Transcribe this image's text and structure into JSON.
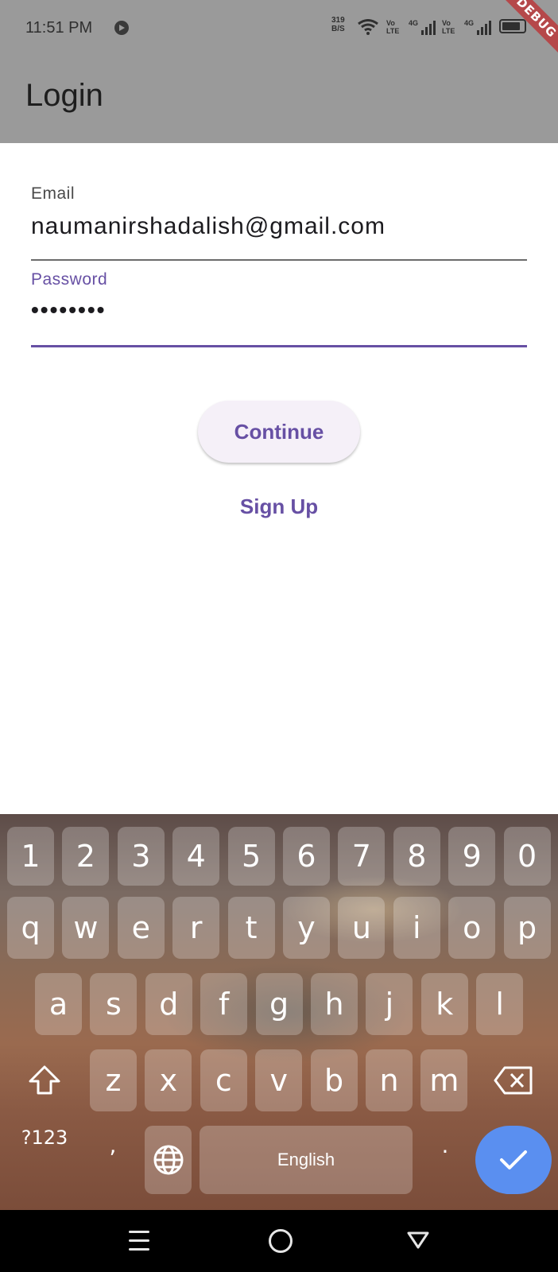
{
  "status_bar": {
    "time": "11:51 PM",
    "net_speed_value": "319",
    "net_speed_unit": "B/S",
    "sim1_type": "Vo\nLTE",
    "sim1_network": "4G",
    "sim2_type": "Vo\nLTE",
    "sim2_network": "4G",
    "battery_level": 0.85
  },
  "debug_banner": "DEBUG",
  "app_bar": {
    "title": "Login"
  },
  "form": {
    "email": {
      "label": "Email",
      "value": "naumanirshadalish@gmail.com"
    },
    "password": {
      "label": "Password",
      "value": "••••••••"
    }
  },
  "buttons": {
    "continue": "Continue",
    "sign_up": "Sign Up"
  },
  "keyboard": {
    "numbers": [
      "1",
      "2",
      "3",
      "4",
      "5",
      "6",
      "7",
      "8",
      "9",
      "0"
    ],
    "row1": [
      "q",
      "w",
      "e",
      "r",
      "t",
      "y",
      "u",
      "i",
      "o",
      "p"
    ],
    "row2": [
      "a",
      "s",
      "d",
      "f",
      "g",
      "h",
      "j",
      "k",
      "l"
    ],
    "row3": [
      "z",
      "x",
      "c",
      "v",
      "b",
      "n",
      "m"
    ],
    "symbols_key": "?123",
    "comma_key": ",",
    "space_label": "English",
    "period_key": "."
  },
  "colors": {
    "accent": "#6750a4",
    "enter_key": "#5a8ff0",
    "debug": "#b5484a"
  },
  "icons": {
    "status": [
      "screen-record-icon",
      "wifi-icon",
      "signal-icon",
      "battery-icon"
    ],
    "keyboard": [
      "shift-icon",
      "backspace-icon",
      "globe-icon",
      "check-icon"
    ],
    "nav": [
      "menu-icon",
      "home-icon",
      "back-icon"
    ]
  }
}
